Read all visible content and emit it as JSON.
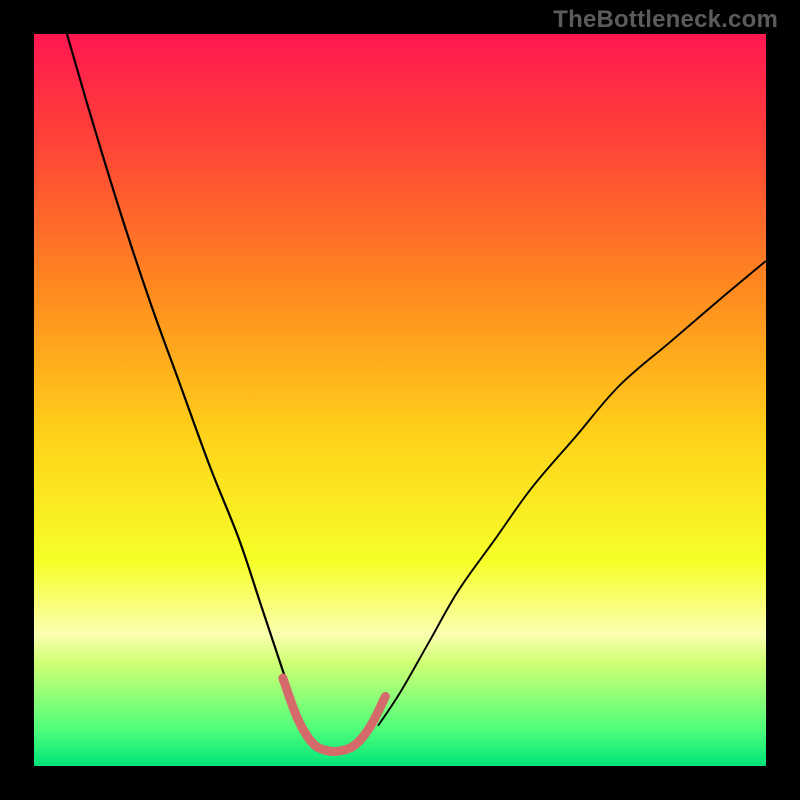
{
  "watermark": "TheBottleneck.com",
  "chart_data": {
    "type": "line",
    "title": "",
    "xlabel": "",
    "ylabel": "",
    "xlim": [
      0,
      100
    ],
    "ylim": [
      0,
      100
    ],
    "grid": false,
    "legend": false,
    "background_gradient_stops": [
      {
        "offset": 0.0,
        "color": "#ff1752"
      },
      {
        "offset": 0.15,
        "color": "#ff4437"
      },
      {
        "offset": 0.35,
        "color": "#ff8a1f"
      },
      {
        "offset": 0.55,
        "color": "#ffd21a"
      },
      {
        "offset": 0.72,
        "color": "#f6ff28"
      },
      {
        "offset": 0.82,
        "color": "#fbffb0"
      },
      {
        "offset": 0.86,
        "color": "#cfff74"
      },
      {
        "offset": 0.95,
        "color": "#4eff7a"
      },
      {
        "offset": 1.0,
        "color": "#00e47a"
      }
    ],
    "series": [
      {
        "name": "left-branch",
        "color": "#000000",
        "width": 2.2,
        "x": [
          4.5,
          8,
          12,
          16,
          20,
          24,
          28,
          31,
          34,
          36.5
        ],
        "y": [
          100,
          88,
          75,
          63,
          52,
          41,
          31,
          22,
          13,
          5.5
        ]
      },
      {
        "name": "right-branch",
        "color": "#000000",
        "width": 1.9,
        "x": [
          47,
          50,
          54,
          58,
          63,
          68,
          74,
          80,
          87,
          94,
          100
        ],
        "y": [
          5.5,
          10,
          17,
          24,
          31,
          38,
          45,
          52,
          58,
          64,
          69
        ]
      },
      {
        "name": "optimum-band",
        "color": "#d46a6a",
        "width": 9,
        "linecap": "round",
        "x": [
          34,
          36,
          38,
          40,
          42,
          44,
          46,
          48
        ],
        "y": [
          12,
          6.5,
          3.2,
          2.1,
          2.1,
          3.0,
          5.5,
          9.5
        ]
      }
    ]
  }
}
